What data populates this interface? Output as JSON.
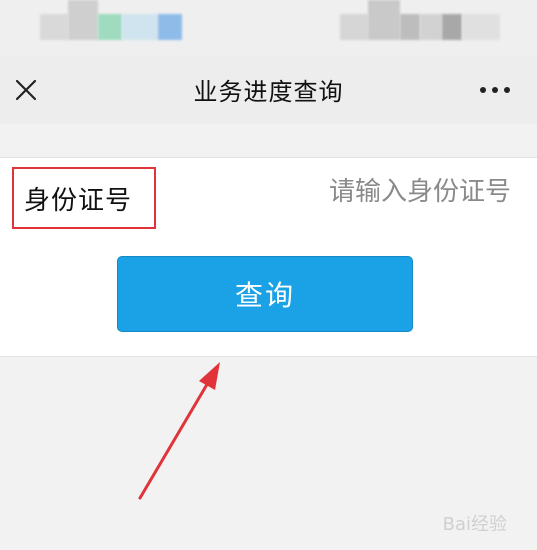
{
  "nav": {
    "title": "业务进度查询",
    "close_icon": "close-icon",
    "more_icon": "more-icon"
  },
  "form": {
    "id_label": "身份证号",
    "id_placeholder": "请输入身份证号",
    "id_value": "",
    "submit_label": "查询"
  },
  "watermark": {
    "text": "Bai经验"
  },
  "colors": {
    "button": "#1aa1e6",
    "highlight_box": "#e0333a",
    "arrow": "#e0333a"
  }
}
